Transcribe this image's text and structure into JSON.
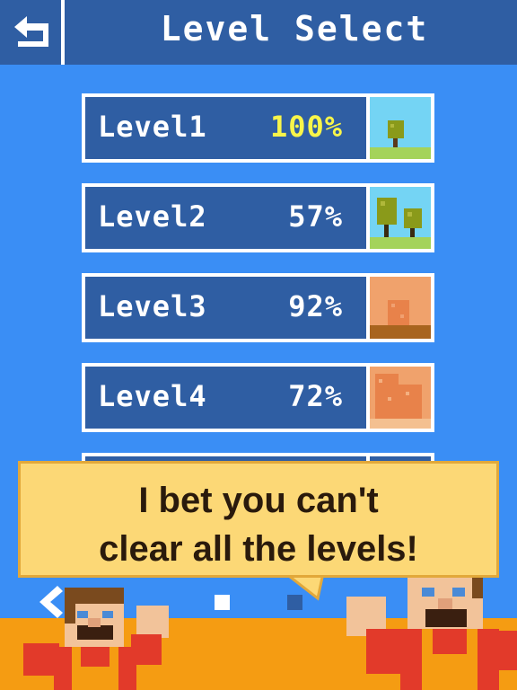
{
  "header": {
    "title": "Level Select",
    "back_icon": "back-arrow-icon"
  },
  "levels": [
    {
      "name": "Level1",
      "percent": "100%",
      "scene": "one-tree-meadow"
    },
    {
      "name": "Level2",
      "percent": "57%",
      "scene": "two-tree-meadow"
    },
    {
      "name": "Level3",
      "percent": "92%",
      "scene": "one-rock-desert"
    },
    {
      "name": "Level4",
      "percent": "72%",
      "scene": "two-rock-desert"
    }
  ],
  "speech": {
    "line1": "I bet you can't",
    "line2": "clear all the levels!"
  },
  "pager": {
    "pages": 2,
    "current": 2,
    "prev_icon": "prev-page-arrow-icon"
  },
  "colors": {
    "background": "#3a8ef5",
    "header": "#2f5ea3",
    "complete_percent": "#f8f54a",
    "ground": "#f59c12",
    "bubble": "#fcd876"
  }
}
